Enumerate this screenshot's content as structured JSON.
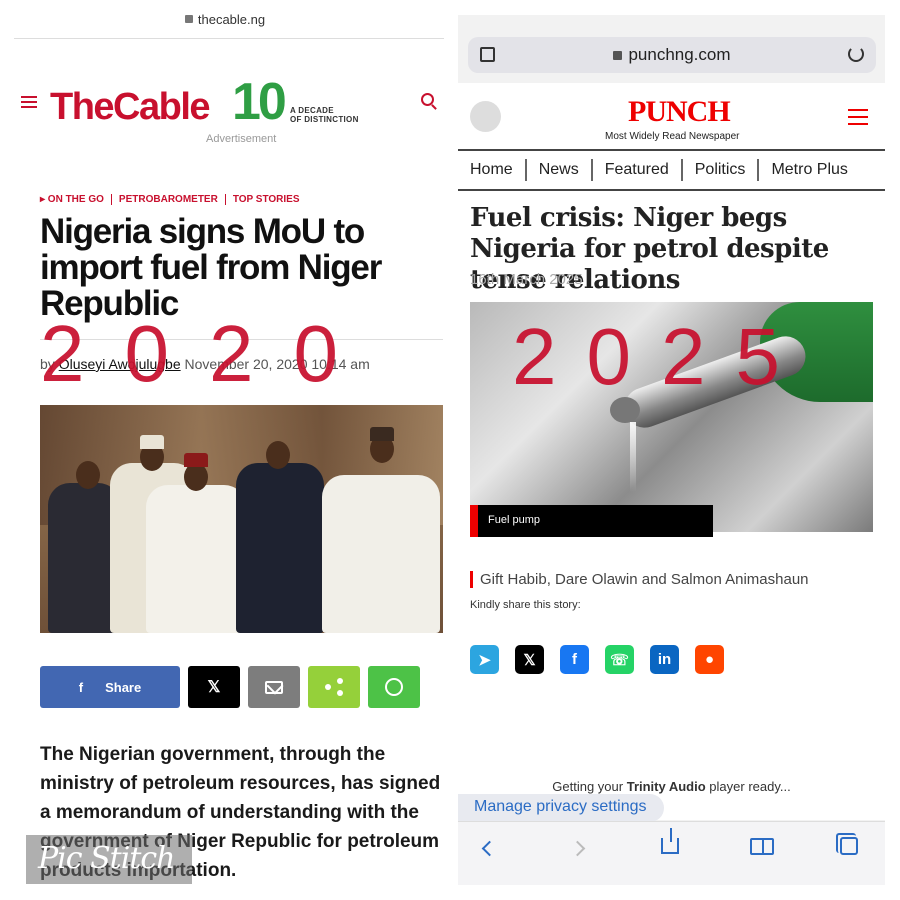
{
  "left": {
    "url": "thecable.ng",
    "logo": {
      "main": "TheCable",
      "decade_number": "10",
      "decade_line1": "A DECADE",
      "decade_line2": "OF DISTINCTION"
    },
    "advertisement": "Advertisement",
    "categories": [
      "▸ ON THE GO",
      "PETROBAROMETER",
      "TOP STORIES"
    ],
    "headline": "Nigeria signs MoU to import fuel from Niger Republic",
    "byline_prefix": "by ",
    "author": "Oluseyi Awojulugbe",
    "date": "November 20, 2020 10:14 am",
    "year_overlay": "2020",
    "share": {
      "facebook_label": "Share",
      "x_icon": "x-icon",
      "email_icon": "email-icon",
      "share_icon": "share-icon",
      "whatsapp_icon": "whatsapp-icon"
    },
    "body_text": "The Nigerian government, through the ministry of petroleum resources, has signed a memorandum of understanding with the government of Niger Republic for petroleum products importation.",
    "watermark": "Pic Stitch"
  },
  "right": {
    "url": "punchng.com",
    "logo": "PUNCH",
    "tagline": "Most Widely Read Newspaper",
    "nav": [
      "Home",
      "News",
      "Featured",
      "Politics",
      "Metro Plus"
    ],
    "headline": "Fuel crisis: Niger begs Nigeria for petrol despite tense relations",
    "date": "16th March 2025",
    "year_overlay": "2025",
    "image_caption": "Fuel pump",
    "authors": "Gift Habib, Dare Olawin and Salmon Animashaun",
    "share_prompt": "Kindly share this story:",
    "social_icons": [
      "telegram-icon",
      "x-icon",
      "facebook-icon",
      "whatsapp-icon",
      "linkedin-icon",
      "reddit-icon"
    ],
    "trinity_prefix": "Getting your ",
    "trinity_brand": "Trinity Audio",
    "trinity_suffix": " player ready...",
    "privacy": "Manage privacy settings"
  },
  "colors": {
    "cable_red": "#c8102e",
    "cable_green": "#2f9e44",
    "punch_red": "#e00000",
    "ios_blue": "#2b6cc4"
  }
}
